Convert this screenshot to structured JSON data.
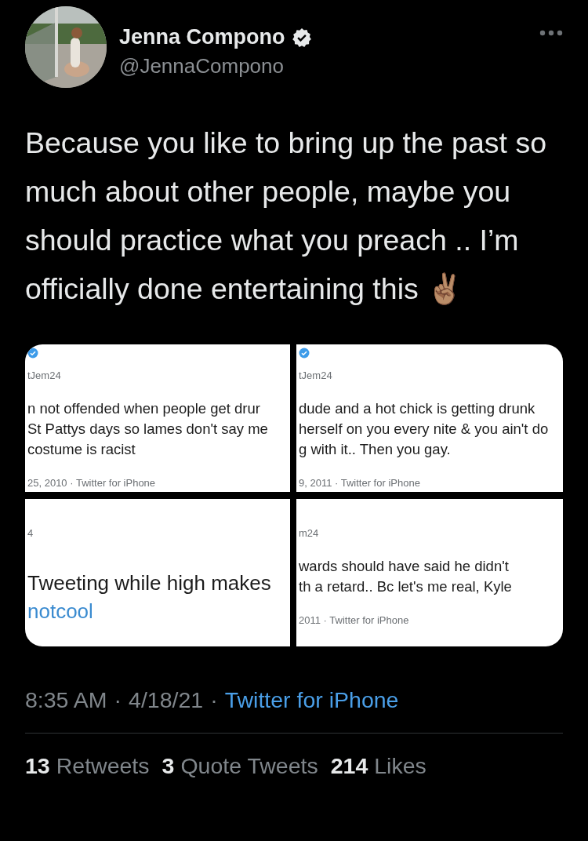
{
  "author": {
    "name": "Jenna Compono",
    "verified": true,
    "handle": "@JennaCompono"
  },
  "tweet": {
    "text": "Because you like to bring up the past so much about other people, maybe you should practice what you preach .. I’m officially done entertaining this ✌🏽"
  },
  "media": [
    {
      "kind": "crop",
      "verified": true,
      "handle": "tJem24",
      "lines": [
        {
          "kind": "text",
          "text": "n not offended when people get drur"
        },
        {
          "kind": "text",
          "text": "St Pattys days so lames don't say me"
        },
        {
          "kind": "text",
          "text": "costume is racist"
        }
      ],
      "date": "25, 2010 · Twitter for iPhone"
    },
    {
      "kind": "crop",
      "verified": true,
      "handle": "tJem24",
      "lines": [
        {
          "kind": "text",
          "text": "dude and a hot chick is getting drunk"
        },
        {
          "kind": "text",
          "text": "herself on you every nite & you ain't do"
        },
        {
          "kind": "text",
          "text": "g with it.. Then you gay."
        }
      ],
      "date": "9, 2011 · Twitter for iPhone"
    },
    {
      "kind": "closeup",
      "verified": false,
      "handle": "4",
      "lines": [
        {
          "kind": "text",
          "text": "Tweeting while high makes"
        },
        {
          "kind": "link",
          "text": "notcool"
        }
      ]
    },
    {
      "kind": "crop",
      "verified": false,
      "handle": "m24",
      "lines": [
        {
          "kind": "text",
          "text": "wards should have said he didn't"
        },
        {
          "kind": "text",
          "text": "th a retard.. Bc let's me real, Kyle"
        }
      ],
      "date": "2011 · Twitter for iPhone"
    }
  ],
  "meta": {
    "time": "8:35 AM",
    "separator": "·",
    "date": "4/18/21",
    "source": "Twitter for iPhone"
  },
  "stats": [
    {
      "count": "13",
      "label": "Retweets"
    },
    {
      "count": "3",
      "label": "Quote Tweets"
    },
    {
      "count": "214",
      "label": "Likes"
    }
  ]
}
